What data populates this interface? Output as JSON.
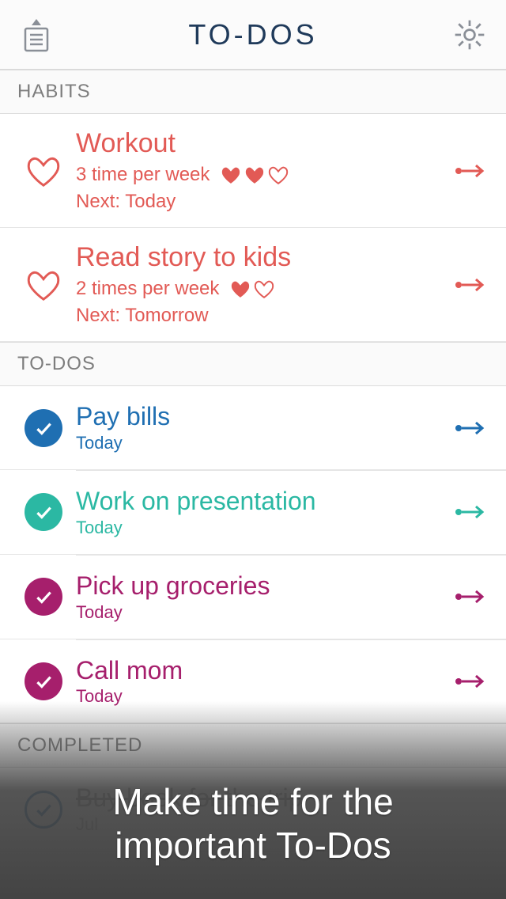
{
  "header": {
    "title": "TO-DOS"
  },
  "sections": {
    "habits_label": "HABITS",
    "todos_label": "TO-DOS",
    "completed_label": "COMPLETED"
  },
  "colors": {
    "habit": "#e25a55",
    "blue": "#1f6fb2",
    "teal": "#2bb8a3",
    "magenta": "#a61f6c"
  },
  "habits": [
    {
      "title": "Workout",
      "frequency": "3 time per week",
      "hearts_filled": 2,
      "hearts_total": 3,
      "next": "Next: Today"
    },
    {
      "title": "Read story to kids",
      "frequency": "2 times per week",
      "hearts_filled": 1,
      "hearts_total": 2,
      "next": "Next: Tomorrow"
    }
  ],
  "todos": [
    {
      "title": "Pay bills",
      "due": "Today",
      "color": "blue"
    },
    {
      "title": "Work on presentation",
      "due": "Today",
      "color": "teal"
    },
    {
      "title": "Pick up groceries",
      "due": "Today",
      "color": "magenta"
    },
    {
      "title": "Call mom",
      "due": "Today",
      "color": "magenta"
    }
  ],
  "completed": [
    {
      "title": "Buy book for the trip",
      "due": "Jul"
    }
  ],
  "overlay_caption_line1": "Make time for the",
  "overlay_caption_line2": "important To-Dos"
}
